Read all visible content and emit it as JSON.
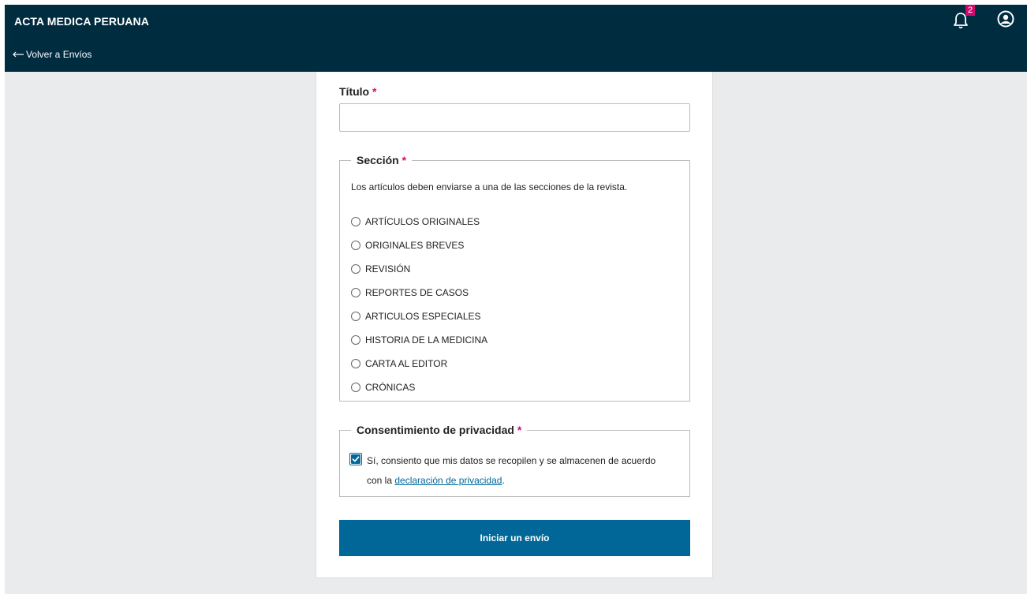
{
  "header": {
    "title": "ACTA MEDICA PERUANA",
    "back_label": "Volver a Envíos",
    "notification_count": "2"
  },
  "form": {
    "title_label": "Título",
    "required_mark": "*",
    "title_value": "",
    "section": {
      "legend": "Sección",
      "description": "Los artículos deben enviarse a una de las secciones de la revista.",
      "options": [
        "ARTÍCULOS ORIGINALES",
        "ORIGINALES BREVES",
        "REVISIÓN",
        "REPORTES DE CASOS",
        "ARTICULOS ESPECIALES",
        "HISTORIA DE LA MEDICINA",
        "CARTA AL EDITOR",
        "CRÓNICAS"
      ]
    },
    "privacy": {
      "legend": "Consentimiento de privacidad",
      "text_before": "Sí, consiento que mis datos se recopilen y se almacenen de acuerdo con la ",
      "link_text": "declaración de privacidad",
      "text_after": ".",
      "checked": true
    },
    "submit_label": "Iniciar un envío"
  },
  "colors": {
    "header_bg": "#002c40",
    "accent": "#006798",
    "required": "#d00a6c",
    "badge": "#d00a6c"
  },
  "icons": {
    "back": "arrow-left-icon",
    "notifications": "bell-icon",
    "user": "user-circle-icon",
    "check": "check-icon"
  }
}
